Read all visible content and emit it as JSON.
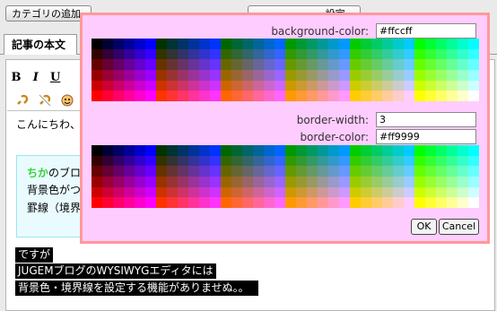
{
  "toolbar_top": {
    "add_category": "カテゴリの追加",
    "other_button": "-- ‑‑ ‑ ‑‑‑‑ ‑ ‑ ‑ ‑ 設定"
  },
  "tabs": {
    "article_body": "記事の本文"
  },
  "editor": {
    "format_buttons": [
      "B",
      "I",
      "U"
    ],
    "greeting": "こんにちわ、",
    "box_lines": {
      "highlight": "ちか",
      "line1_rest": "のブロ",
      "line2": "背景色がつ",
      "line3": "罫線（境界"
    },
    "selected_lines": [
      "ですが",
      "JUGEMブログのWYSIWYGエディタには",
      "背景色・境界線を設定する機能がありませぬ。。"
    ]
  },
  "popup": {
    "background_color_label": "background-color:",
    "background_color_value": "#ffccff",
    "border_width_label": "border-width:",
    "border_width_value": "3",
    "border_color_label": "border-color:",
    "border_color_value": "#ff9999",
    "ok_label": "OK",
    "cancel_label": "Cancel"
  },
  "colors": {
    "popup_bg": "#ffccff",
    "popup_border": "#ff9999",
    "box_bg": "#e9fbff",
    "box_border": "#9ce5f4"
  }
}
